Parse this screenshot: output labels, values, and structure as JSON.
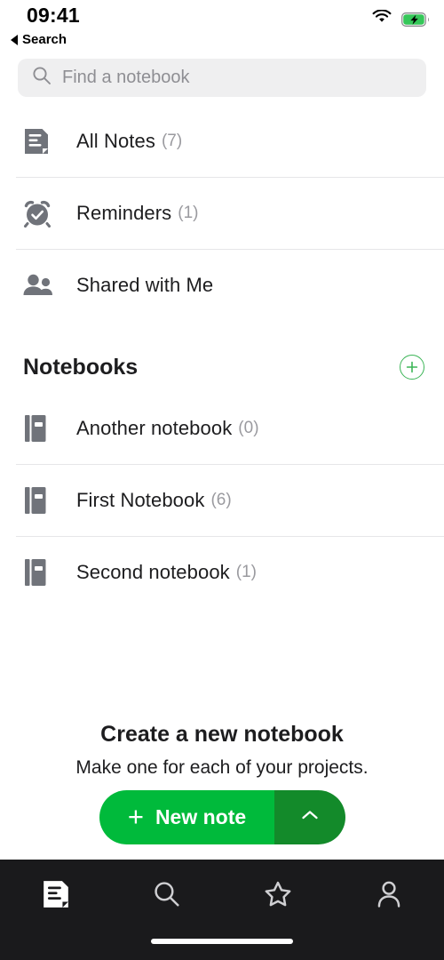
{
  "status": {
    "time": "09:41",
    "wifi_icon": "wifi-icon",
    "battery_icon": "battery-charging-icon",
    "battery_color": "#35c759"
  },
  "nav": {
    "back_label": "Search",
    "back_icon": "back-triangle-icon"
  },
  "search": {
    "placeholder": "Find a notebook",
    "value": "",
    "icon": "search-icon"
  },
  "main_items": [
    {
      "label": "All Notes",
      "count": "(7)",
      "icon": "note-document-icon"
    },
    {
      "label": "Reminders",
      "count": "(1)",
      "icon": "alarm-clock-check-icon"
    },
    {
      "label": "Shared with Me",
      "count": "",
      "icon": "people-icon"
    }
  ],
  "notebooks_section": {
    "title": "Notebooks",
    "add_icon": "plus-circle-icon",
    "add_color": "#3cb557",
    "items": [
      {
        "label": "Another notebook",
        "count": "(0)",
        "icon": "notebook-icon"
      },
      {
        "label": "First Notebook",
        "count": "(6)",
        "icon": "notebook-icon"
      },
      {
        "label": "Second notebook",
        "count": "(1)",
        "icon": "notebook-icon"
      }
    ]
  },
  "cta": {
    "title": "Create a new notebook",
    "subtitle": "Make one for each of your projects.",
    "button_label": "New note",
    "button_plus_icon": "plus-icon",
    "button_chevron_icon": "chevron-up-icon",
    "button_color": "#00ba3b",
    "button_chevron_color": "#138a2a"
  },
  "tabbar": {
    "background": "#1a1a1c",
    "tabs": [
      {
        "name": "notes",
        "icon": "note-document-icon",
        "active": true
      },
      {
        "name": "search",
        "icon": "search-icon",
        "active": false
      },
      {
        "name": "shortcuts",
        "icon": "star-icon",
        "active": false
      },
      {
        "name": "account",
        "icon": "person-icon",
        "active": false
      }
    ]
  }
}
